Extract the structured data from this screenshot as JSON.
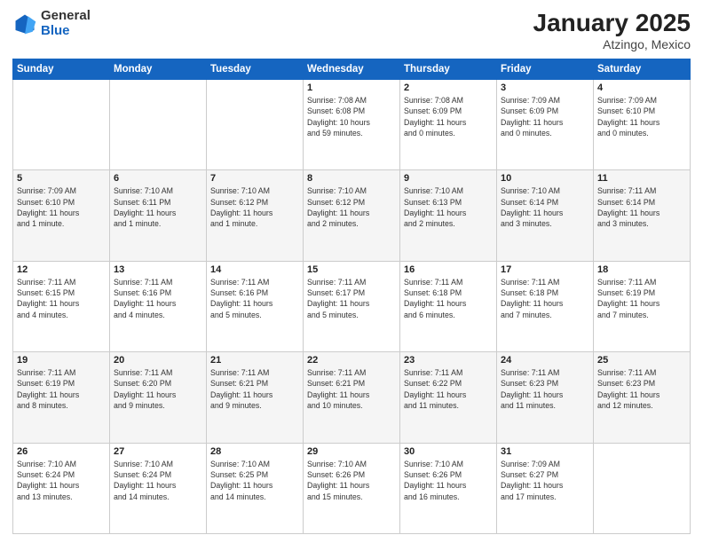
{
  "logo": {
    "general": "General",
    "blue": "Blue"
  },
  "header": {
    "title": "January 2025",
    "location": "Atzingo, Mexico"
  },
  "weekdays": [
    "Sunday",
    "Monday",
    "Tuesday",
    "Wednesday",
    "Thursday",
    "Friday",
    "Saturday"
  ],
  "weeks": [
    [
      {
        "day": "",
        "info": ""
      },
      {
        "day": "",
        "info": ""
      },
      {
        "day": "",
        "info": ""
      },
      {
        "day": "1",
        "info": "Sunrise: 7:08 AM\nSunset: 6:08 PM\nDaylight: 10 hours\nand 59 minutes."
      },
      {
        "day": "2",
        "info": "Sunrise: 7:08 AM\nSunset: 6:09 PM\nDaylight: 11 hours\nand 0 minutes."
      },
      {
        "day": "3",
        "info": "Sunrise: 7:09 AM\nSunset: 6:09 PM\nDaylight: 11 hours\nand 0 minutes."
      },
      {
        "day": "4",
        "info": "Sunrise: 7:09 AM\nSunset: 6:10 PM\nDaylight: 11 hours\nand 0 minutes."
      }
    ],
    [
      {
        "day": "5",
        "info": "Sunrise: 7:09 AM\nSunset: 6:10 PM\nDaylight: 11 hours\nand 1 minute."
      },
      {
        "day": "6",
        "info": "Sunrise: 7:10 AM\nSunset: 6:11 PM\nDaylight: 11 hours\nand 1 minute."
      },
      {
        "day": "7",
        "info": "Sunrise: 7:10 AM\nSunset: 6:12 PM\nDaylight: 11 hours\nand 1 minute."
      },
      {
        "day": "8",
        "info": "Sunrise: 7:10 AM\nSunset: 6:12 PM\nDaylight: 11 hours\nand 2 minutes."
      },
      {
        "day": "9",
        "info": "Sunrise: 7:10 AM\nSunset: 6:13 PM\nDaylight: 11 hours\nand 2 minutes."
      },
      {
        "day": "10",
        "info": "Sunrise: 7:10 AM\nSunset: 6:14 PM\nDaylight: 11 hours\nand 3 minutes."
      },
      {
        "day": "11",
        "info": "Sunrise: 7:11 AM\nSunset: 6:14 PM\nDaylight: 11 hours\nand 3 minutes."
      }
    ],
    [
      {
        "day": "12",
        "info": "Sunrise: 7:11 AM\nSunset: 6:15 PM\nDaylight: 11 hours\nand 4 minutes."
      },
      {
        "day": "13",
        "info": "Sunrise: 7:11 AM\nSunset: 6:16 PM\nDaylight: 11 hours\nand 4 minutes."
      },
      {
        "day": "14",
        "info": "Sunrise: 7:11 AM\nSunset: 6:16 PM\nDaylight: 11 hours\nand 5 minutes."
      },
      {
        "day": "15",
        "info": "Sunrise: 7:11 AM\nSunset: 6:17 PM\nDaylight: 11 hours\nand 5 minutes."
      },
      {
        "day": "16",
        "info": "Sunrise: 7:11 AM\nSunset: 6:18 PM\nDaylight: 11 hours\nand 6 minutes."
      },
      {
        "day": "17",
        "info": "Sunrise: 7:11 AM\nSunset: 6:18 PM\nDaylight: 11 hours\nand 7 minutes."
      },
      {
        "day": "18",
        "info": "Sunrise: 7:11 AM\nSunset: 6:19 PM\nDaylight: 11 hours\nand 7 minutes."
      }
    ],
    [
      {
        "day": "19",
        "info": "Sunrise: 7:11 AM\nSunset: 6:19 PM\nDaylight: 11 hours\nand 8 minutes."
      },
      {
        "day": "20",
        "info": "Sunrise: 7:11 AM\nSunset: 6:20 PM\nDaylight: 11 hours\nand 9 minutes."
      },
      {
        "day": "21",
        "info": "Sunrise: 7:11 AM\nSunset: 6:21 PM\nDaylight: 11 hours\nand 9 minutes."
      },
      {
        "day": "22",
        "info": "Sunrise: 7:11 AM\nSunset: 6:21 PM\nDaylight: 11 hours\nand 10 minutes."
      },
      {
        "day": "23",
        "info": "Sunrise: 7:11 AM\nSunset: 6:22 PM\nDaylight: 11 hours\nand 11 minutes."
      },
      {
        "day": "24",
        "info": "Sunrise: 7:11 AM\nSunset: 6:23 PM\nDaylight: 11 hours\nand 11 minutes."
      },
      {
        "day": "25",
        "info": "Sunrise: 7:11 AM\nSunset: 6:23 PM\nDaylight: 11 hours\nand 12 minutes."
      }
    ],
    [
      {
        "day": "26",
        "info": "Sunrise: 7:10 AM\nSunset: 6:24 PM\nDaylight: 11 hours\nand 13 minutes."
      },
      {
        "day": "27",
        "info": "Sunrise: 7:10 AM\nSunset: 6:24 PM\nDaylight: 11 hours\nand 14 minutes."
      },
      {
        "day": "28",
        "info": "Sunrise: 7:10 AM\nSunset: 6:25 PM\nDaylight: 11 hours\nand 14 minutes."
      },
      {
        "day": "29",
        "info": "Sunrise: 7:10 AM\nSunset: 6:26 PM\nDaylight: 11 hours\nand 15 minutes."
      },
      {
        "day": "30",
        "info": "Sunrise: 7:10 AM\nSunset: 6:26 PM\nDaylight: 11 hours\nand 16 minutes."
      },
      {
        "day": "31",
        "info": "Sunrise: 7:09 AM\nSunset: 6:27 PM\nDaylight: 11 hours\nand 17 minutes."
      },
      {
        "day": "",
        "info": ""
      }
    ]
  ]
}
